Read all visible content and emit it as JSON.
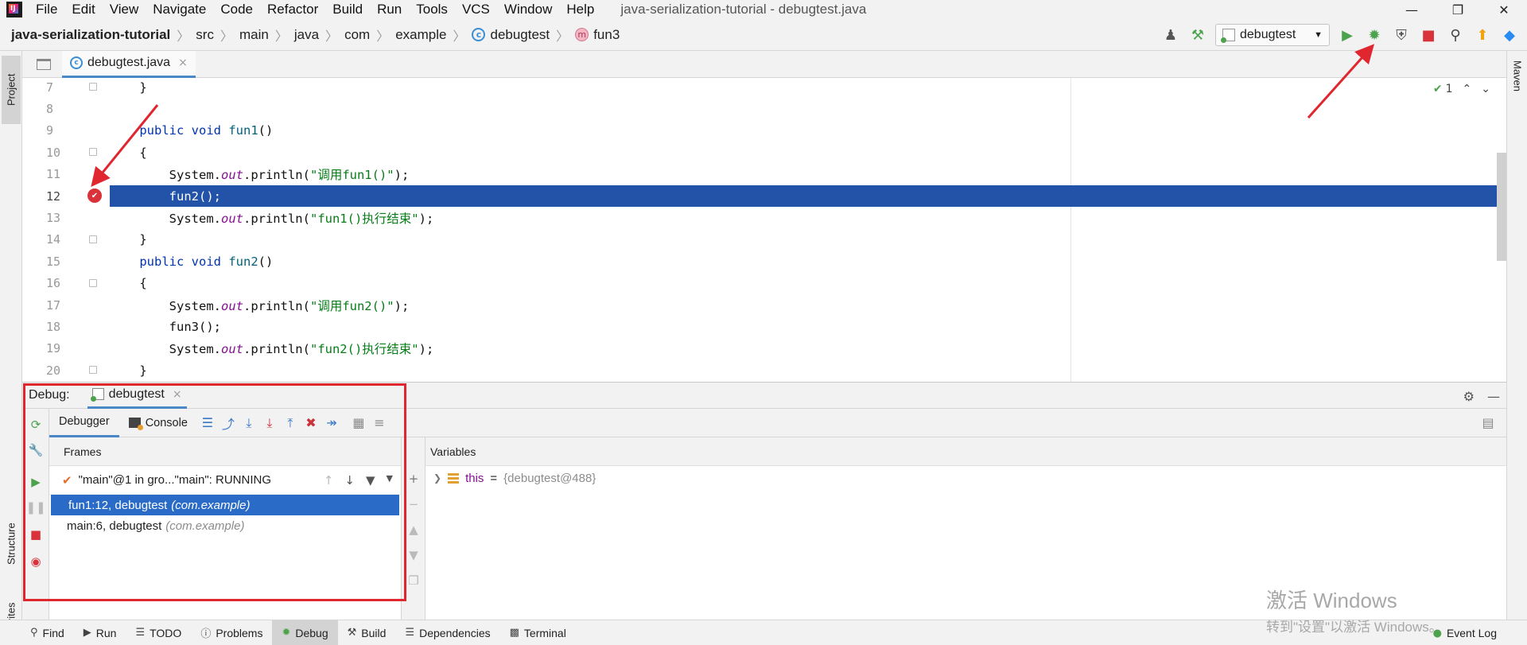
{
  "menubar": {
    "items": [
      "File",
      "Edit",
      "View",
      "Navigate",
      "Code",
      "Refactor",
      "Build",
      "Run",
      "Tools",
      "VCS",
      "Window",
      "Help"
    ],
    "window_title": "java-serialization-tutorial - debugtest.java"
  },
  "breadcrumb": {
    "project": "java-serialization-tutorial",
    "items": [
      "src",
      "main",
      "java",
      "com",
      "example"
    ],
    "class": "debugtest",
    "method": "fun3"
  },
  "toolbar": {
    "run_config": "debugtest"
  },
  "side_tabs": {
    "project": "Project",
    "structure": "Structure",
    "favorites": "Favorites",
    "maven": "Maven"
  },
  "editor": {
    "tab_name": "debugtest.java",
    "inspection_count": "1",
    "lines": [
      {
        "no": "7",
        "code": "    }"
      },
      {
        "no": "8",
        "code": ""
      },
      {
        "no": "9",
        "code": "    public void fun1()"
      },
      {
        "no": "10",
        "code": "    {"
      },
      {
        "no": "11",
        "code": "        System.out.println(\"调用fun1()\");"
      },
      {
        "no": "12",
        "code": "        fun2();"
      },
      {
        "no": "13",
        "code": "        System.out.println(\"fun1()执行结束\");"
      },
      {
        "no": "14",
        "code": "    }"
      },
      {
        "no": "15",
        "code": "    public void fun2()"
      },
      {
        "no": "16",
        "code": "    {"
      },
      {
        "no": "17",
        "code": "        System.out.println(\"调用fun2()\");"
      },
      {
        "no": "18",
        "code": "        fun3();"
      },
      {
        "no": "19",
        "code": "        System.out.println(\"fun2()执行结束\");"
      },
      {
        "no": "20",
        "code": "    }"
      }
    ],
    "current_line": "12"
  },
  "debug": {
    "label": "Debug:",
    "session": "debugtest",
    "tabs": {
      "debugger": "Debugger",
      "console": "Console"
    },
    "frames_title": "Frames",
    "thread": "\"main\"@1 in gro...\"main\": RUNNING",
    "frames": [
      {
        "method": "fun1:12, debugtest",
        "pkg": "(com.example)"
      },
      {
        "method": "main:6, debugtest",
        "pkg": "(com.example)"
      }
    ],
    "variables_title": "Variables",
    "variable": {
      "name": "this",
      "value": "{debugtest@488}"
    }
  },
  "bottom_bar": {
    "tabs": [
      "Find",
      "Run",
      "TODO",
      "Problems",
      "Debug",
      "Build",
      "Dependencies",
      "Terminal"
    ],
    "event_log": "Event Log"
  },
  "watermark": {
    "line1": "激活 Windows",
    "line2": "转到\"设置\"以激活 Windows。"
  },
  "colors": {
    "highlight_red": "#e0262f",
    "current_line_blue": "#2253a8",
    "selected_frame_blue": "#2a6bc7"
  }
}
